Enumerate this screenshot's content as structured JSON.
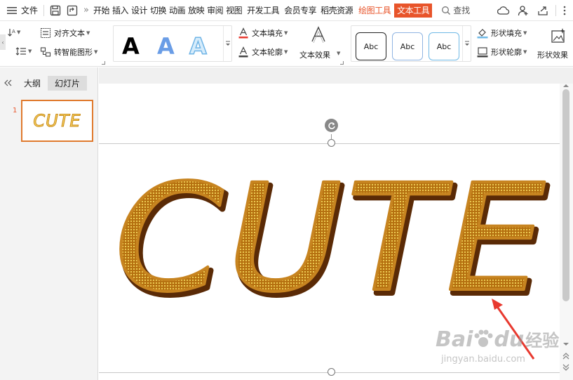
{
  "menubar": {
    "file_label": "文件",
    "tabs": [
      "开始",
      "插入",
      "设计",
      "切换",
      "动画",
      "放映",
      "审阅",
      "视图",
      "开发工具",
      "会员专享",
      "稻壳资源"
    ],
    "drawing_tools": "绘图工具",
    "text_tools": "文本工具",
    "search_label": "查找"
  },
  "ribbon": {
    "align_text": "对齐文本",
    "smart_graphic": "转智能图形",
    "text_fill": "文本填充",
    "text_outline": "文本轮廓",
    "text_effect": "文本效果",
    "style_letter": "A",
    "shape_style_label": "Abc",
    "shape_fill": "形状填充",
    "shape_outline": "形状轮廓",
    "shape_effect": "形状效果"
  },
  "leftpanel": {
    "tab_outline": "大纲",
    "tab_slides": "幻灯片",
    "slide_number": "1",
    "thumb_text": "CUTE"
  },
  "slide": {
    "text": "CUTE"
  },
  "watermark": {
    "brand_a": "Bai",
    "brand_b": "du",
    "brand_c": "经验",
    "url": "jingyan.baidu.com"
  },
  "colors": {
    "accent": "#e8542a",
    "text_fill_dark": "#7a3b0c",
    "text_fill_light": "#e8b531",
    "arrow": "#e8392f"
  }
}
